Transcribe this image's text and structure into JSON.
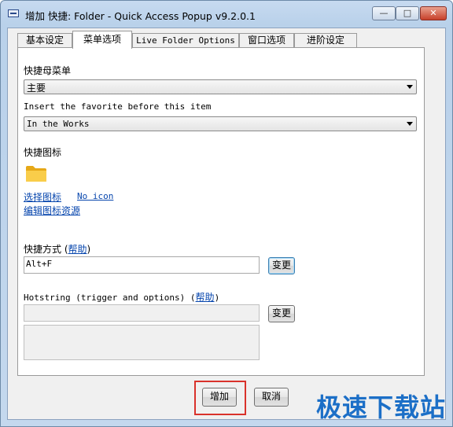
{
  "window": {
    "title": "增加 快捷: Folder - Quick Access Popup v9.2.0.1",
    "min_glyph": "—",
    "max_glyph": "□",
    "close_glyph": "✕"
  },
  "tabs": [
    {
      "label": "基本设定"
    },
    {
      "label": "菜单选项"
    },
    {
      "label": "Live Folder Options"
    },
    {
      "label": "窗口选项"
    },
    {
      "label": "进阶设定"
    }
  ],
  "active_tab": 1,
  "menu": {
    "parent_label": "快捷母菜单",
    "parent_value": "主要",
    "insert_label": "Insert the favorite before this item",
    "insert_value": "In the Works"
  },
  "icon_section": {
    "label": "快捷图标",
    "icon": "folder-icon",
    "select_icon_link": "选择图标",
    "no_icon_link": "No icon",
    "edit_icon_link": "编辑图标资源"
  },
  "shortcut": {
    "label": "快捷方式 (",
    "help_link": "帮助",
    "label_end": ")",
    "value": "Alt+F",
    "change_button": "变更"
  },
  "hotstring": {
    "label": "Hotstring (trigger and options) (",
    "help_link": "帮助",
    "label_end": ")",
    "value": "",
    "change_button": "变更"
  },
  "footer": {
    "add_button": "增加",
    "cancel_button": "取消"
  },
  "watermark": "极速下载站",
  "colors": {
    "link": "#0645ad",
    "highlight": "#d9322b",
    "watermark": "#1c6fc7",
    "folder": "#f4c430"
  }
}
